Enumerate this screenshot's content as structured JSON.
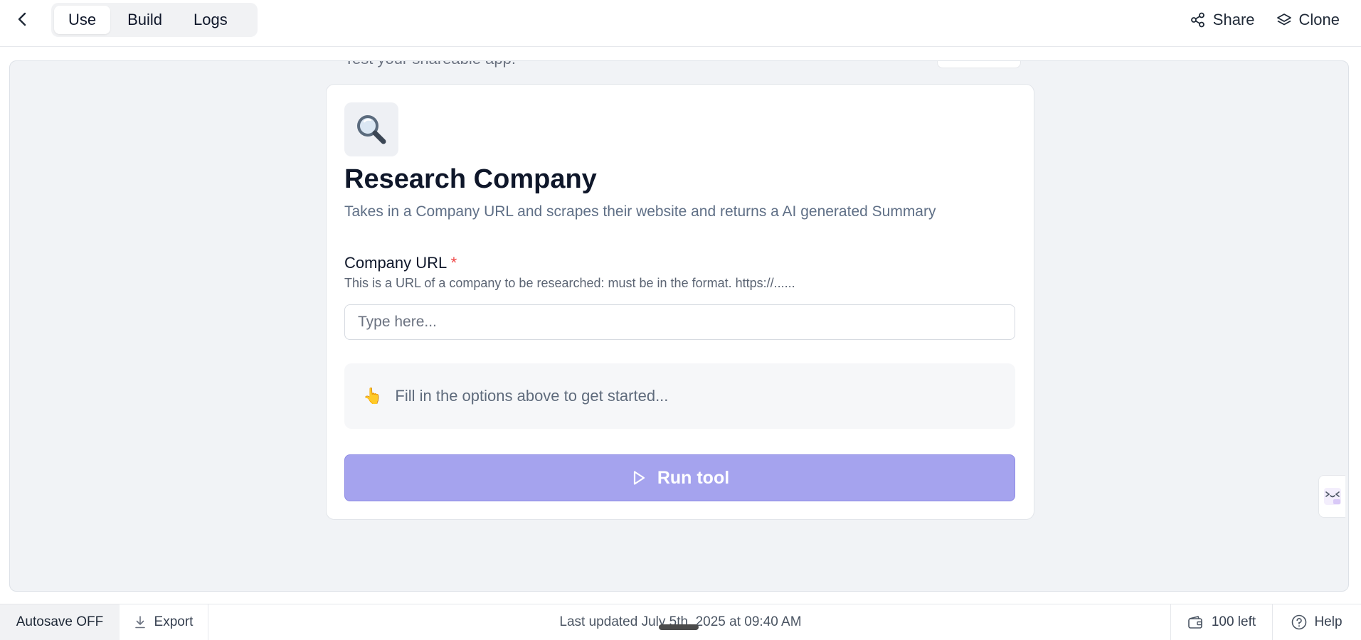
{
  "header": {
    "tabs": [
      {
        "label": "Use",
        "active": true
      },
      {
        "label": "Build",
        "active": false
      },
      {
        "label": "Logs",
        "active": false
      }
    ],
    "share_label": "Share",
    "clone_label": "Clone"
  },
  "canvas": {
    "peek_text": "Test your shareable app."
  },
  "card": {
    "icon": "magnifying-glass-icon",
    "title": "Research Company",
    "description": "Takes in a Company URL and scrapes their website and returns a AI generated Summary",
    "field": {
      "label": "Company URL",
      "required_mark": "*",
      "help": "This is a URL of a company to be researched: must be in the format. https://......",
      "placeholder": "Type here...",
      "value": ""
    },
    "hint": {
      "emoji": "👆",
      "text": "Fill in the options above to get started..."
    },
    "run_label": "Run tool"
  },
  "footer": {
    "autosave_label": "Autosave OFF",
    "export_label": "Export",
    "last_updated": "Last updated July 5th, 2025 at 09:40 AM",
    "credits_label": "100 left",
    "help_label": "Help"
  },
  "colors": {
    "accent": "#a5a3ee",
    "canvas_bg": "#f1f3f6",
    "required": "#ef4444"
  }
}
